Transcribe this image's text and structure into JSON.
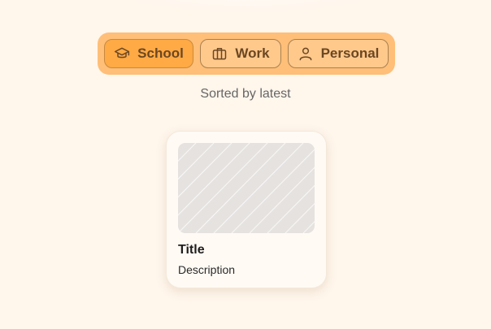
{
  "tabs": [
    {
      "label": "School",
      "icon": "graduation-cap-icon",
      "active": true
    },
    {
      "label": "Work",
      "icon": "briefcase-icon",
      "active": false
    },
    {
      "label": "Personal",
      "icon": "user-icon",
      "active": false
    }
  ],
  "sort_label": "Sorted by latest",
  "card": {
    "title": "Title",
    "description": "Description"
  },
  "colors": {
    "background": "#fff6ec",
    "tabbar": "#ffbf78",
    "tab_active": "#ffaa45",
    "tab_text": "#6b4722"
  }
}
